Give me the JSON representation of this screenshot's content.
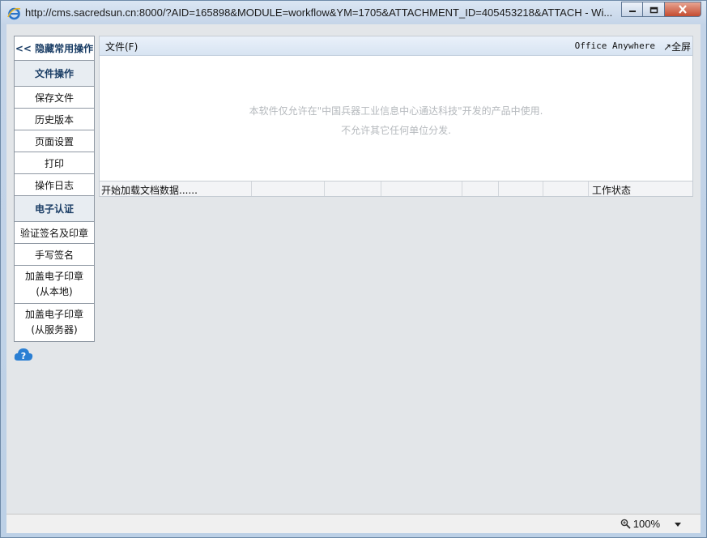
{
  "window": {
    "title": "http://cms.sacredsun.cn:8000/?AID=165898&MODULE=workflow&YM=1705&ATTACHMENT_ID=405453218&ATTACH - Wi..."
  },
  "sidebar": {
    "toggle_label": "<< 隐藏常用操作",
    "file_ops_header": "文件操作",
    "file_ops": [
      "保存文件",
      "历史版本",
      "页面设置",
      "打印",
      "操作日志"
    ],
    "esign_header": "电子认证",
    "esign_ops": [
      "验证签名及印章",
      "手写签名"
    ],
    "stamp_local": [
      "加盖电子印章",
      "(从本地)"
    ],
    "stamp_server": [
      "加盖电子印章",
      "(从服务器)"
    ]
  },
  "editor": {
    "menu_file": "文件(F)",
    "brand": "Office Anywhere",
    "fullscreen": "↗全屏",
    "notice_line1": "本软件仅允许在\"中国兵器工业信息中心通达科技\"开发的产品中使用.",
    "notice_line2": "不允许其它任何单位分发.",
    "status_loading": "开始加载文档数据......",
    "status_work": "工作状态"
  },
  "browser": {
    "zoom": "100%"
  },
  "colors": {
    "header_text": "#1b3e66",
    "notice_text": "#b5b9bd",
    "client_bg": "#e3e6e9"
  },
  "icons": [
    "ie-icon",
    "minimize-icon",
    "restore-icon",
    "close-icon",
    "help-icon",
    "zoom-icon",
    "chevron-down-icon"
  ]
}
